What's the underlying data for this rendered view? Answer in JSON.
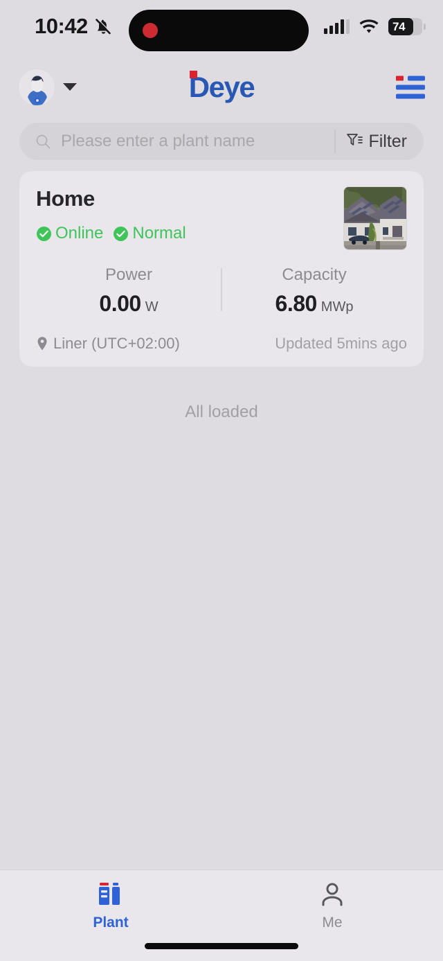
{
  "status_bar": {
    "time": "10:42",
    "mute_icon": "bell-slash-icon",
    "signal_icon": "cellular-signal-icon",
    "wifi_icon": "wifi-icon",
    "battery_level": "74",
    "battery_percent": 74,
    "recording_indicator": "red-recording-dot"
  },
  "header": {
    "avatar_icon": "user-avatar-icon",
    "dropdown_icon": "chevron-down-icon",
    "brand": "Deye",
    "brand_color": "#2857b4",
    "brand_accent_color": "#d9232e",
    "menu_icon": "hamburger-menu-icon"
  },
  "search": {
    "placeholder": "Please enter a plant name",
    "value": "",
    "search_icon": "search-icon",
    "filter_label": "Filter",
    "filter_icon": "filter-funnel-icon"
  },
  "plant_card": {
    "title": "Home",
    "thumbnail_icon": "house-solar-panel-photo",
    "badges": [
      {
        "label": "Online",
        "icon": "check-circle-icon",
        "color": "#3fc45a"
      },
      {
        "label": "Normal",
        "icon": "check-circle-icon",
        "color": "#3fc45a"
      }
    ],
    "metrics": [
      {
        "label": "Power",
        "value": "0.00",
        "unit": "W"
      },
      {
        "label": "Capacity",
        "value": "6.80",
        "unit": "MWp"
      }
    ],
    "location_icon": "location-pin-icon",
    "location": "Liner  (UTC+02:00)",
    "updated": "Updated  5mins ago"
  },
  "list_footer": {
    "text": "All loaded"
  },
  "tabbar": {
    "active_color": "#2f62d4",
    "inactive_color": "#8d8b91",
    "items": [
      {
        "label": "Plant",
        "icon": "plant-icon",
        "active": true
      },
      {
        "label": "Me",
        "icon": "person-icon",
        "active": false
      }
    ]
  }
}
